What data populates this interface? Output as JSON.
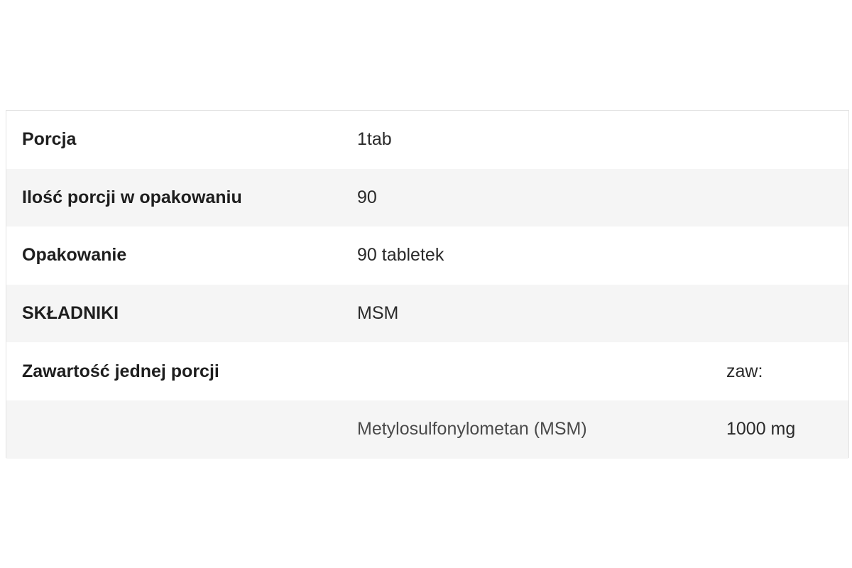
{
  "table": {
    "rows": [
      {
        "label": "Porcja",
        "value": "1tab",
        "value3": ""
      },
      {
        "label": "Ilość porcji w opakowaniu",
        "value": "90",
        "value3": ""
      },
      {
        "label": "Opakowanie",
        "value": "90 tabletek",
        "value3": ""
      },
      {
        "label": "SKŁADNIKI",
        "value": "MSM",
        "value3": ""
      },
      {
        "label": "Zawartość jednej porcji",
        "value": "",
        "value3": "zaw:"
      },
      {
        "label": "",
        "value": "Metylosulfonylometan (MSM)",
        "value3": "1000 mg"
      }
    ]
  },
  "colors": {
    "row_alt_background": "#f5f5f5",
    "border": "#e3e3e3",
    "text": "#1e1e1e"
  }
}
